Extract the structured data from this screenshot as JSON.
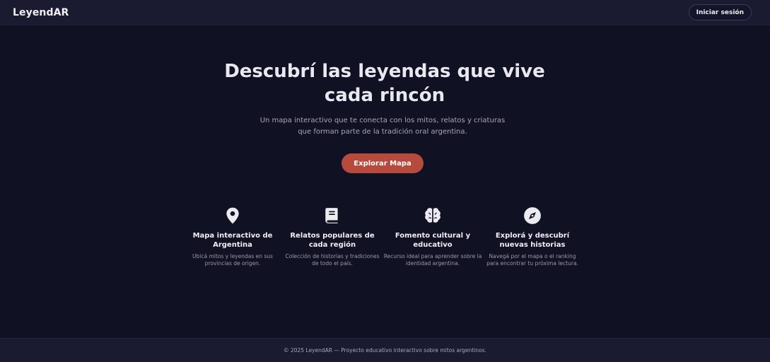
{
  "header": {
    "logo": "LeyendAR",
    "login_label": "Iniciar sesión"
  },
  "hero": {
    "title": "Descubrí las leyendas que vive cada rincón",
    "subtitle": "Un mapa interactivo que te conecta con los mitos, relatos y criaturas que forman parte de la tradición oral argentina.",
    "cta_label": "Explorar Mapa"
  },
  "features": [
    {
      "icon": "map-pin-icon",
      "title": "Mapa interactivo de Argentina",
      "description": "Ubicá mitos y leyendas en sus provincias de origen."
    },
    {
      "icon": "book-icon",
      "title": "Relatos populares de cada región",
      "description": "Colección de historias y tradiciones de todo el país."
    },
    {
      "icon": "brain-icon",
      "title": "Fomento cultural y educativo",
      "description": "Recurso ideal para aprender sobre la identidad argentina."
    },
    {
      "icon": "compass-icon",
      "title": "Explorá y descubrí nuevas historias",
      "description": "Navegá por el mapa o el ranking para encontrar tu próxima lectura."
    }
  ],
  "footer": {
    "text": "© 2025 LeyendAR — Proyecto educativo interactivo sobre mitos argentinos."
  },
  "colors": {
    "background": "#111124",
    "navbar": "#1a1b30",
    "accent": "#b54a3d"
  }
}
